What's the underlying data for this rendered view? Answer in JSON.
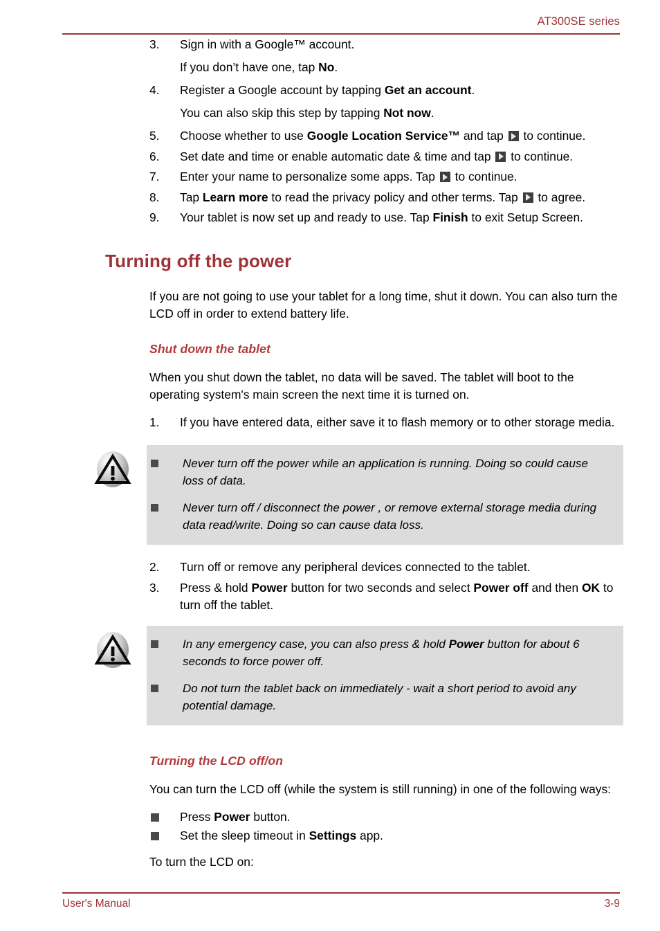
{
  "header": {
    "series_label": "AT300SE series",
    "rule_color": "#9e3236"
  },
  "footer": {
    "manual_label": "User's Manual",
    "page_number": "3-9",
    "rule_color": "#9e3236"
  },
  "colors": {
    "heading_red": "#9e3236",
    "subheading_red": "#b03a3a",
    "caution_background": "#dcdcdc",
    "bullet_square": "#4a4a4a",
    "next_icon_background": "#3d3d3d"
  },
  "setup_steps": [
    {
      "number": "3.",
      "text": "Sign in with a Google™ account.",
      "sub": "If you don’t have one, tap ",
      "sub_bold": "No",
      "sub_tail": "."
    },
    {
      "number": "4.",
      "text_pre": "Register a Google account by tapping ",
      "text_bold": "Get an account",
      "text_post": ".",
      "sub": "You can also skip this step by tapping ",
      "sub_bold": "Not now",
      "sub_tail": "."
    },
    {
      "number": "5.",
      "text_pre": "Choose whether to use ",
      "text_bold": "Google Location Service™",
      "text_post": " and tap ",
      "icon": "next-arrow-icon",
      "text_tail": " to continue."
    },
    {
      "number": "6.",
      "text_pre": "Set date and time or enable automatic date & time and tap ",
      "icon": "next-arrow-icon",
      "text_tail": " to continue."
    },
    {
      "number": "7.",
      "text_pre": "Enter your name to personalize some apps. Tap ",
      "icon": "next-arrow-icon",
      "text_tail": " to continue."
    },
    {
      "number": "8.",
      "text_pre": "Tap ",
      "text_bold": "Learn more",
      "text_post": " to read the privacy policy and other terms. Tap ",
      "icon": "next-arrow-icon",
      "text_tail": " to agree."
    },
    {
      "number": "9.",
      "text_pre": "Your tablet is now set up and ready to use. Tap ",
      "text_bold": "Finish",
      "text_post": " to exit Setup Screen."
    }
  ],
  "section": {
    "title": "Turning off the power",
    "intro": "If you are not going to use your tablet for a long time, shut it down. You can also turn the LCD off in order to extend battery life."
  },
  "shutdown": {
    "heading": "Shut down the tablet",
    "intro": "When you shut down the tablet, no data will be saved. The tablet will boot to the operating system's main screen the next time it is turned on.",
    "step1_number": "1.",
    "step1_text": "If you have entered data, either save it to flash memory or to other storage media.",
    "step2_number": "2.",
    "step2_text": "Turn off or remove any peripheral devices connected to the tablet.",
    "step3_number": "3.",
    "step3_pre": "Press & hold ",
    "step3_bold1": "Power",
    "step3_mid": " button for two seconds and select ",
    "step3_bold2": "Power off",
    "step3_mid2": " and then ",
    "step3_bold3": "OK",
    "step3_tail": " to turn off the tablet."
  },
  "caution_1": {
    "icon": "warning-triangle-icon",
    "items": [
      "Never turn off the power while an application is running. Doing so could cause loss of data.",
      "Never turn off / disconnect the power , or remove external storage media during data read/write. Doing so can cause data loss."
    ]
  },
  "caution_2": {
    "icon": "warning-triangle-icon",
    "item1_pre": "In any emergency case, you can also press & hold ",
    "item1_bold": "Power",
    "item1_post": " button for about 6 seconds to force power off.",
    "item2": "Do not turn the tablet back on immediately - wait a short period to avoid any potential damage."
  },
  "lcd": {
    "heading": "Turning the LCD off/on",
    "intro": "You can turn the LCD off (while the system is still running) in one of the following ways:",
    "bullet1_pre": "Press ",
    "bullet1_bold": "Power",
    "bullet1_post": " button.",
    "bullet2_pre": "Set the sleep timeout in ",
    "bullet2_bold": "Settings",
    "bullet2_post": " app.",
    "outro": "To turn the LCD on:"
  }
}
